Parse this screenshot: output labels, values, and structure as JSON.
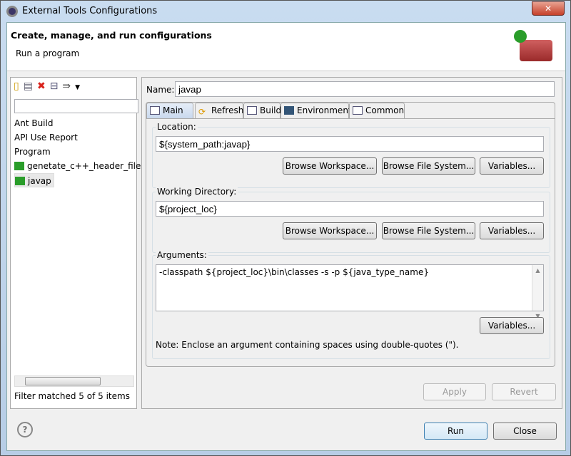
{
  "window": {
    "title": "External Tools Configurations",
    "close": "✕"
  },
  "header": {
    "title": "Create, manage, and run configurations",
    "subtitle": "Run a program"
  },
  "left": {
    "filter_value": "",
    "items": [
      {
        "label": "Ant Build"
      },
      {
        "label": "API Use Report"
      },
      {
        "label": "Program"
      },
      {
        "label": "genetate_c++_header_file",
        "icon": "program-launch-icon"
      },
      {
        "label": "javap",
        "icon": "program-launch-icon",
        "selected": true
      }
    ],
    "status": "Filter matched 5 of 5 items"
  },
  "form": {
    "name_label": "Name:",
    "name_value": "javap",
    "tabs": [
      {
        "label": "Main"
      },
      {
        "label": "Refresh"
      },
      {
        "label": "Build"
      },
      {
        "label": "Environment"
      },
      {
        "label": "Common"
      }
    ],
    "location": {
      "label": "Location:",
      "value": "${system_path:javap}"
    },
    "workdir": {
      "label": "Working Directory:",
      "value": "${project_loc}"
    },
    "browse_workspace": "Browse Workspace...",
    "browse_fs": "Browse File System...",
    "variables": "Variables...",
    "arguments": {
      "label": "Arguments:",
      "value": "-classpath ${project_loc}\\bin\\classes -s -p ${java_type_name}"
    },
    "note": "Note: Enclose an argument containing spaces using double-quotes (\")."
  },
  "buttons": {
    "apply": "Apply",
    "revert": "Revert",
    "run": "Run",
    "close": "Close",
    "help": "?"
  },
  "colors": {
    "accent": "#3c7fb1",
    "delete": "#d9231c",
    "run_green": "#2a9d2a"
  }
}
